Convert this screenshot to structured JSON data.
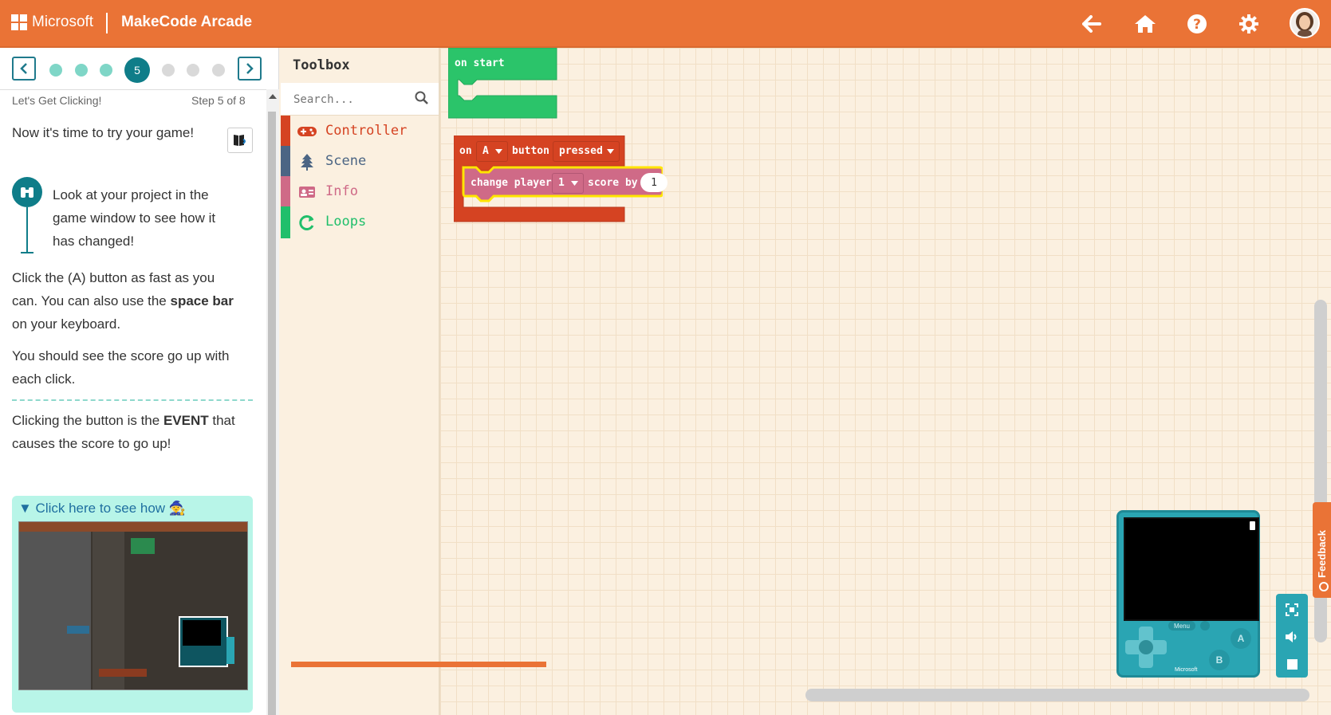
{
  "app": {
    "ms_label": "Microsoft",
    "product": "MakeCode Arcade"
  },
  "colors": {
    "accent": "#ea7336",
    "teal": "#0f7d89",
    "controller": "#d54322",
    "scene": "#4b6584",
    "info": "#cf6a87",
    "loops": "#20bf6b"
  },
  "topbar": {
    "icons": [
      "back-arrow-icon",
      "home-icon",
      "help-icon",
      "settings-icon",
      "avatar"
    ]
  },
  "tutorial": {
    "current_step": "5",
    "title": "Let's Get Clicking!",
    "step_label": "Step 5 of 8",
    "intro": "Now it's time to try your game!",
    "tip": "Look at your project in the game window to see how it has changed!",
    "para1_a": "Click the (A) button as fast as you can. You can also use the ",
    "para1_bold": "space bar",
    "para1_b": " on your keyboard.",
    "para2": "You should see the score go up with each click.",
    "para3_a": "Clicking the button is the ",
    "para3_bold": "EVENT",
    "para3_b": " that causes the score to go up!",
    "hint": "▼ Click here to see how 🧙"
  },
  "toolbox": {
    "title": "Toolbox",
    "search_placeholder": "Search...",
    "categories": [
      {
        "label": "Controller",
        "icon": "gamepad-icon"
      },
      {
        "label": "Scene",
        "icon": "tree-icon"
      },
      {
        "label": "Info",
        "icon": "id-card-icon"
      },
      {
        "label": "Loops",
        "icon": "loop-arrow-icon"
      }
    ]
  },
  "blocks": {
    "on_start": "on start",
    "event_on": "on",
    "event_button_value": "A",
    "event_button_word": "button",
    "event_action": "pressed",
    "change_label": "change player",
    "player_value": "1",
    "score_by": "score by",
    "amount_value": "1"
  },
  "simulator": {
    "menu_label": "Menu",
    "btn_a": "A",
    "btn_b": "B",
    "brand": "Microsoft"
  },
  "feedback": "Feedback"
}
